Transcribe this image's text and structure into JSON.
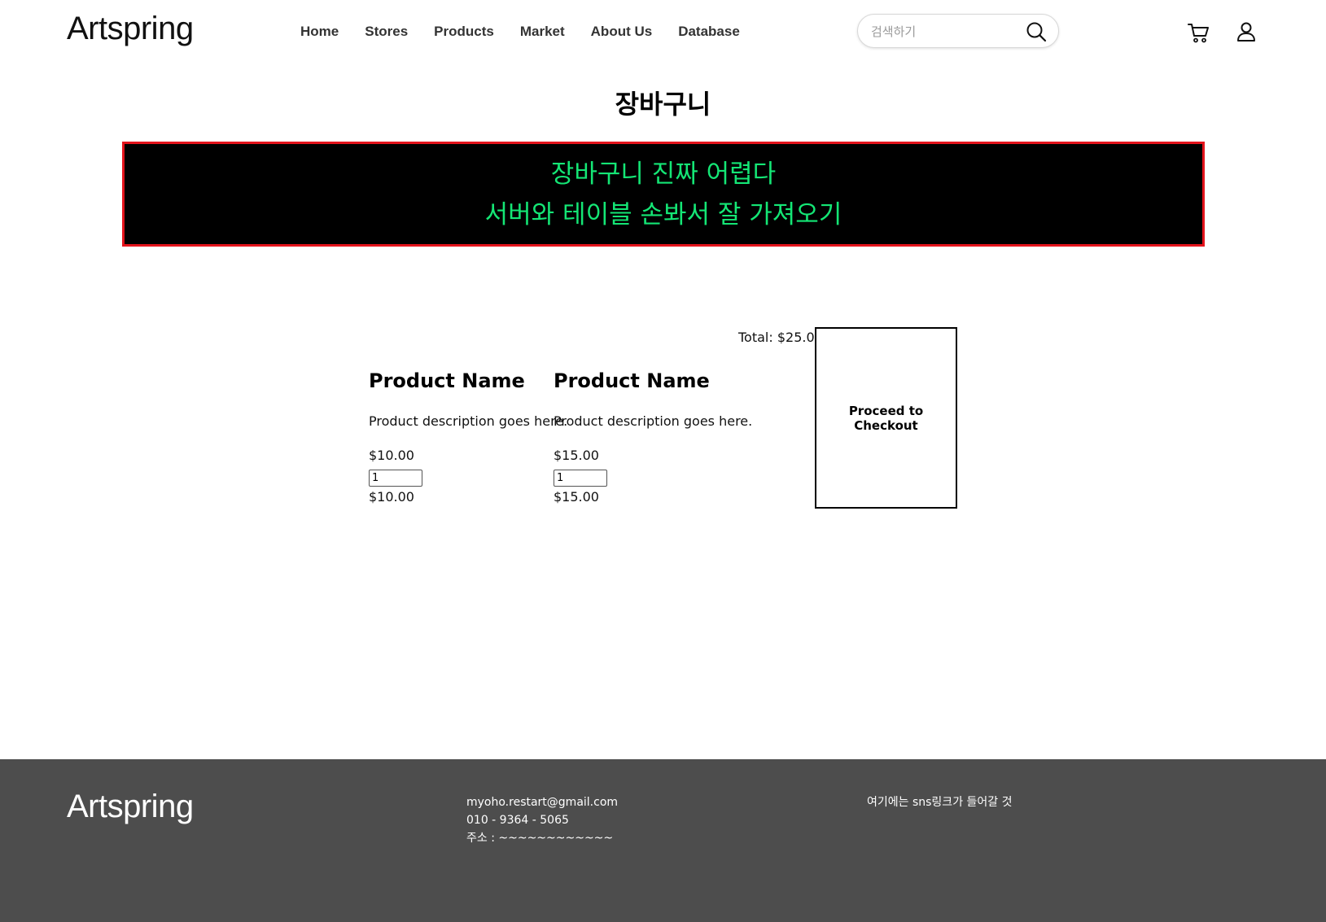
{
  "header": {
    "logo": "Artspring",
    "nav": [
      "Home",
      "Stores",
      "Products",
      "Market",
      "About Us",
      "Database"
    ],
    "search_placeholder": "검색하기"
  },
  "page_title": "장바구니",
  "banner": {
    "line1": "장바구니 진짜 어렵다",
    "line2": "서버와 테이블 손봐서 잘 가져오기"
  },
  "cart": {
    "total": "Total: $25.00",
    "checkout_label": "Proceed to Checkout",
    "items": [
      {
        "name": "Product Name",
        "description": "Product description goes here.",
        "price": "$10.00",
        "quantity": "1",
        "subtotal": "$10.00"
      },
      {
        "name": "Product Name",
        "description": "Product description goes here.",
        "price": "$15.00",
        "quantity": "1",
        "subtotal": "$15.00"
      }
    ]
  },
  "footer": {
    "logo": "Artspring",
    "email": "myoho.restart@gmail.com",
    "phone": "010 - 9364 - 5065",
    "address": "주소 : ~~~~~~~~~~~~",
    "sns": "여기에는 sns링크가 들어갈 것"
  },
  "colors": {
    "banner_bg": "#000000",
    "banner_text": "#14e675",
    "banner_border": "#e4141c",
    "footer_bg": "#4d4d4d"
  }
}
